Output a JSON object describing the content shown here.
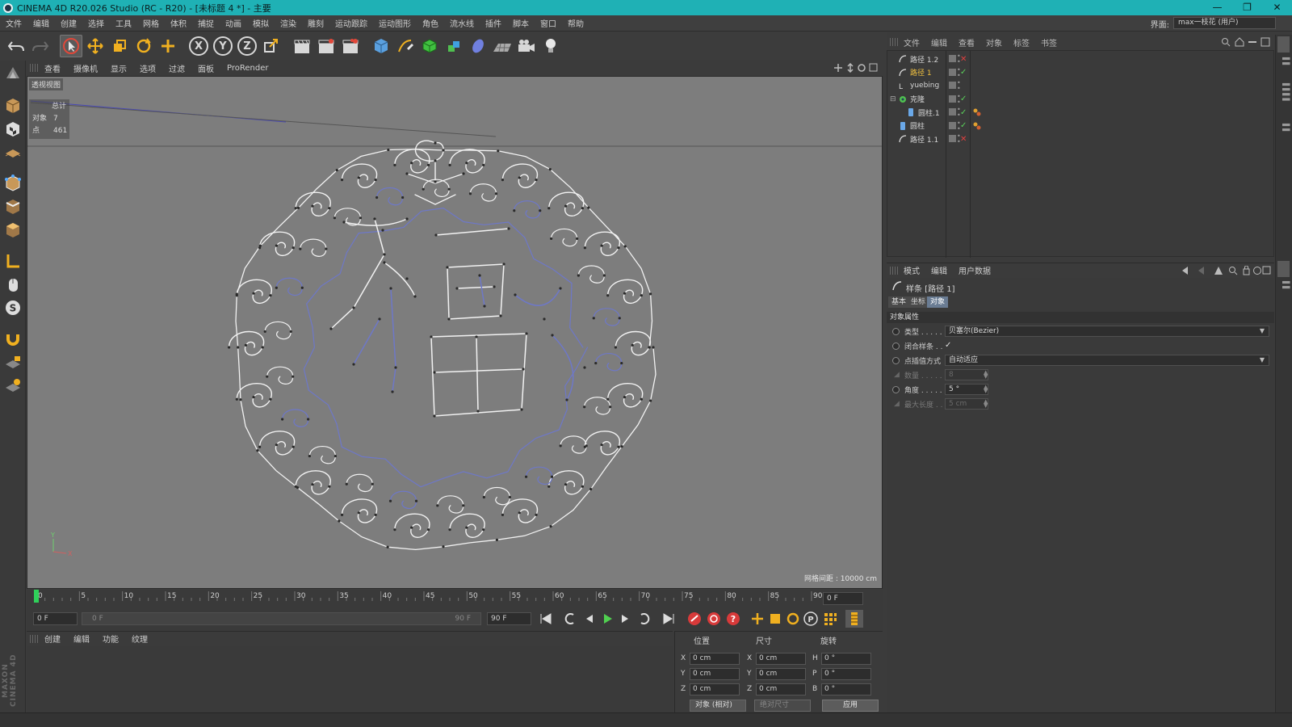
{
  "window": {
    "title": "CINEMA 4D R20.026 Studio (RC - R20) - [未标题 4 *] - 主要",
    "buttons": [
      "—",
      "❐",
      "✕"
    ]
  },
  "menu": {
    "items": [
      "文件",
      "编辑",
      "创建",
      "选择",
      "工具",
      "网格",
      "体积",
      "捕捉",
      "动画",
      "模拟",
      "渲染",
      "雕刻",
      "运动跟踪",
      "运动图形",
      "角色",
      "流水线",
      "插件",
      "脚本",
      "窗口",
      "帮助"
    ],
    "layout_label": "界面:",
    "layout_value": "max一枝花 (用户)"
  },
  "toolbar": {
    "axis_x": "X",
    "axis_y": "Y",
    "axis_z": "Z"
  },
  "viewport": {
    "menu": [
      "查看",
      "摄像机",
      "显示",
      "选项",
      "过滤",
      "面板",
      "ProRender"
    ],
    "name": "透视视图",
    "stats_header": "总计",
    "stats": [
      {
        "label": "对象",
        "value": "7"
      },
      {
        "label": "点",
        "value": "461"
      }
    ],
    "grid_info": "网格间距 : 10000 cm",
    "colors": {
      "background": "#7d7d7d",
      "spline_white": "#f2f2f2",
      "spline_blue": "#6e78c8"
    }
  },
  "timeline": {
    "ticks": [
      "0",
      "5",
      "10",
      "15",
      "20",
      "25",
      "30",
      "35",
      "40",
      "45",
      "50",
      "55",
      "60",
      "65",
      "70",
      "75",
      "80",
      "85",
      "90"
    ],
    "current_frame_field": "0 F",
    "start_field": "0 F",
    "range_start": "0 F",
    "range_end": "90 F",
    "end_field": "90 F"
  },
  "material_menu": [
    "创建",
    "编辑",
    "功能",
    "纹理"
  ],
  "coords": {
    "headers": [
      "位置",
      "尺寸",
      "旋转"
    ],
    "rows": [
      {
        "axis": "X",
        "pos": "0 cm",
        "size_axis": "X",
        "size": "0 cm",
        "rot_axis": "H",
        "rot": "0 °"
      },
      {
        "axis": "Y",
        "pos": "0 cm",
        "size_axis": "Y",
        "size": "0 cm",
        "rot_axis": "P",
        "rot": "0 °"
      },
      {
        "axis": "Z",
        "pos": "0 cm",
        "size_axis": "Z",
        "size": "0 cm",
        "rot_axis": "B",
        "rot": "0 °"
      }
    ],
    "mode_select": "对象 (相对)",
    "size_select": "绝对尺寸",
    "apply": "应用"
  },
  "object_manager": {
    "menu": [
      "文件",
      "编辑",
      "查看",
      "对象",
      "标签",
      "书签"
    ],
    "objects": [
      {
        "name": "路径 1.2",
        "indent": 0,
        "highlight": false,
        "status": "x"
      },
      {
        "name": "路径 1",
        "indent": 0,
        "highlight": true,
        "status": "check"
      },
      {
        "name": "yuebing",
        "indent": 0,
        "highlight": false,
        "status": "none"
      },
      {
        "name": "克隆",
        "indent": 0,
        "highlight": false,
        "status": "check"
      },
      {
        "name": "圆柱.1",
        "indent": 1,
        "highlight": false,
        "status": "check"
      },
      {
        "name": "圆柱",
        "indent": 0,
        "highlight": false,
        "status": "check"
      },
      {
        "name": "路径 1.1",
        "indent": 0,
        "highlight": false,
        "status": "x"
      }
    ]
  },
  "attribute_manager": {
    "menu": [
      "模式",
      "编辑",
      "用户数据"
    ],
    "object_title": "样条 [路径 1]",
    "tabs": [
      "基本",
      "坐标",
      "对象"
    ],
    "section": "对象属性",
    "rows": [
      {
        "label": "类型 . . . . .",
        "kind": "dropdown",
        "value": "贝塞尔(Bezier)",
        "dim": false
      },
      {
        "label": "闭合样条 . .",
        "kind": "check",
        "value": "✓",
        "dim": false
      },
      {
        "label": "点插值方式",
        "kind": "dropdown",
        "value": "自动适应",
        "dim": false
      },
      {
        "label": "数量 . . . . .",
        "kind": "num",
        "value": "8",
        "dim": true
      },
      {
        "label": "角度 . . . . .",
        "kind": "num",
        "value": "5 °",
        "dim": false
      },
      {
        "label": "最大长度 . .",
        "kind": "num",
        "value": "5 cm",
        "dim": true
      }
    ]
  },
  "brand": "MAXON CINEMA 4D"
}
